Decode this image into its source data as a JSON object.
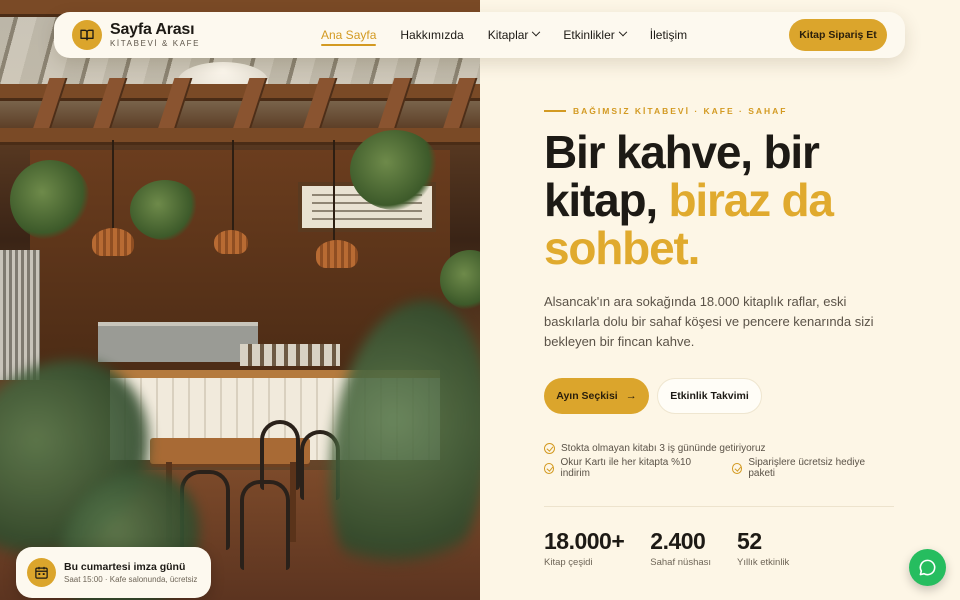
{
  "brand": {
    "name": "Sayfa Arası",
    "tagline": "KİTABEVİ & KAFE",
    "logo_icon": "open-book-icon"
  },
  "nav": {
    "items": [
      {
        "label": "Ana Sayfa",
        "active": true
      },
      {
        "label": "Hakkımızda",
        "active": false
      },
      {
        "label": "Kitaplar",
        "active": false,
        "dropdown": true
      },
      {
        "label": "Etkinlikler",
        "active": false,
        "dropdown": true
      },
      {
        "label": "İletişim",
        "active": false
      }
    ],
    "cta_label": "Kitap Sipariş Et"
  },
  "hero": {
    "eyebrow": "BAĞIMSIZ KİTABEVİ · KAFE · SAHAF",
    "headline_dark": "Bir kahve, bir kitap, ",
    "headline_accent": "biraz da sohbet.",
    "lead": "Alsancak'ın ara sokağında 18.000 kitaplık raflar, eski baskılarla dolu bir sahaf köşesi ve pencere kenarında sizi bekleyen bir fincan kahve.",
    "primary_button": "Ayın Seçkisi",
    "primary_button_icon": "arrow-right-icon",
    "secondary_button": "Etkinlik Takvimi",
    "features": [
      "Stokta olmayan kitabı 3 iş gününde getiriyoruz",
      "Okur Kartı ile her kitapta %10 indirim",
      "Siparişlere ücretsiz hediye paketi"
    ],
    "stats": [
      {
        "value": "18.000+",
        "label": "Kitap çeşidi"
      },
      {
        "value": "2.400",
        "label": "Sahaf nüshası"
      },
      {
        "value": "52",
        "label": "Yıllık etkinlik"
      }
    ]
  },
  "event_card": {
    "icon": "calendar-icon",
    "title": "Bu cumartesi imza günü",
    "subtitle": "Saat 15:00 · Kafe salonunda, ücretsiz"
  },
  "chat": {
    "icon": "chat-bubble-icon"
  },
  "colors": {
    "accent": "#dba52c",
    "accent_text": "#d39a22",
    "background": "#fdf6e6",
    "chat": "#26bd5f"
  }
}
